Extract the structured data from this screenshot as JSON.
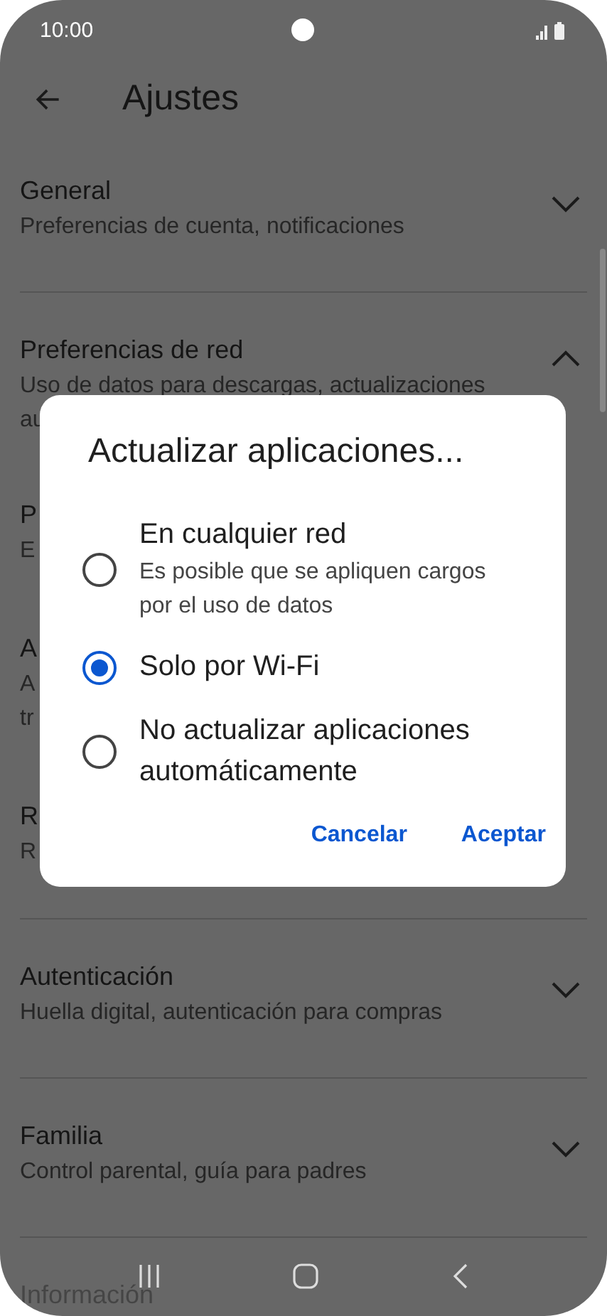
{
  "status_bar": {
    "time": "10:00"
  },
  "header": {
    "title": "Ajustes"
  },
  "settings": [
    {
      "title": "General",
      "subtitle": [
        "Preferencias de cuenta, notificaciones"
      ],
      "expanded": false
    },
    {
      "title": "Preferencias de red",
      "subtitle": [
        "Uso de datos para descargas, actualizaciones",
        "au"
      ],
      "expanded": true,
      "children": [
        {
          "title": "P",
          "subtitle": [
            "E"
          ]
        },
        {
          "title": "A",
          "subtitle": [
            "A",
            "tr"
          ]
        },
        {
          "title": "R",
          "subtitle": [
            "R"
          ]
        }
      ]
    },
    {
      "title": "Autenticación",
      "subtitle": [
        "Huella digital, autenticación para compras"
      ],
      "expanded": false
    },
    {
      "title": "Familia",
      "subtitle": [
        "Control parental, guía para padres"
      ],
      "expanded": false
    },
    {
      "title": "Información"
    }
  ],
  "dialog": {
    "title": "Actualizar aplicaciones...",
    "options": [
      {
        "label": "En cualquier red",
        "description": "Es posible que se apliquen cargos por el uso de datos",
        "selected": false
      },
      {
        "label": "Solo por Wi-Fi",
        "selected": true
      },
      {
        "label": "No actualizar aplicaciones automáticamente",
        "selected": false
      }
    ],
    "buttons": [
      "Cancelar",
      "Aceptar"
    ]
  }
}
